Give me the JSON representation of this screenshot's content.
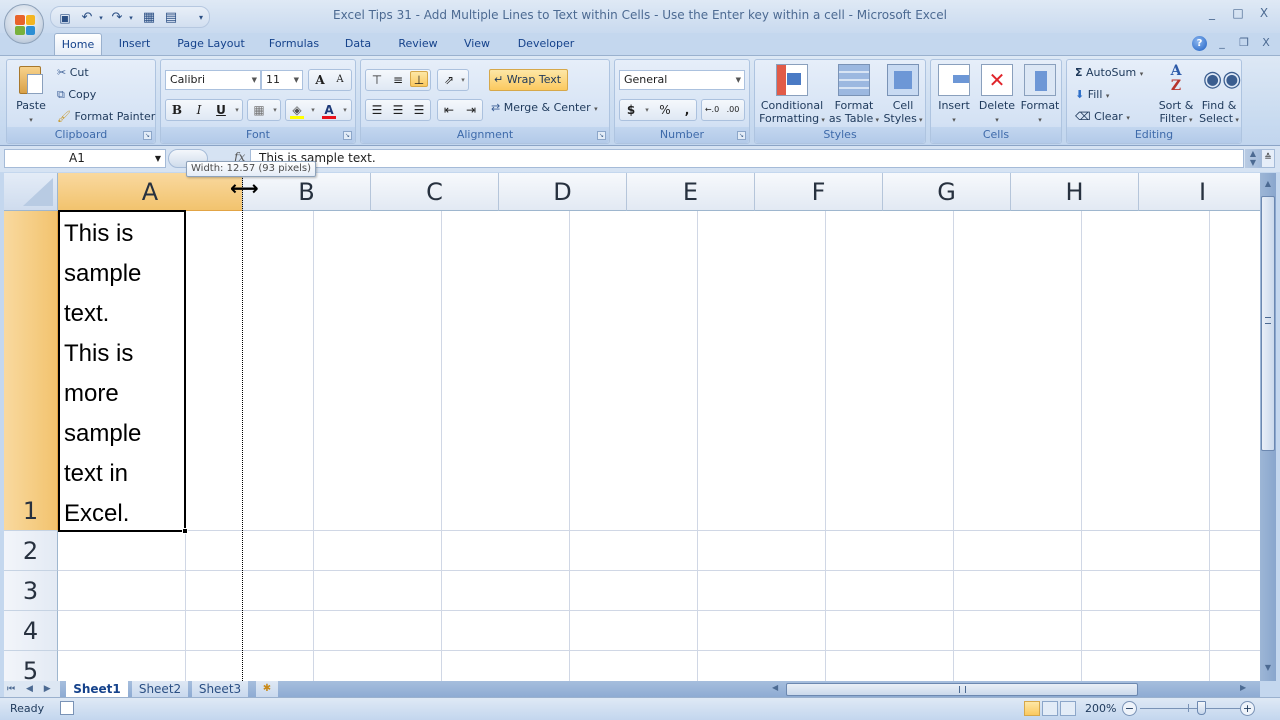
{
  "window": {
    "title": "Excel Tips 31 - Add Multiple Lines to Text within Cells - Use the Enter key within a cell - Microsoft Excel",
    "controls": {
      "minimize": "_",
      "maximize": "□",
      "close": "X"
    },
    "doc_controls": {
      "minimize": "_",
      "restore": "❐",
      "close": "X",
      "help": "?"
    }
  },
  "quick_access": [
    {
      "name": "save-icon",
      "glyph": "💾"
    },
    {
      "name": "undo-icon",
      "glyph": "↶"
    },
    {
      "name": "redo-icon",
      "glyph": "↷"
    },
    {
      "name": "print-preview-icon",
      "glyph": "▦"
    },
    {
      "name": "form-icon",
      "glyph": "▤"
    },
    {
      "name": "customize-icon",
      "glyph": "▾"
    }
  ],
  "tabs": [
    {
      "label": "Home",
      "active": true
    },
    {
      "label": "Insert"
    },
    {
      "label": "Page Layout"
    },
    {
      "label": "Formulas"
    },
    {
      "label": "Data"
    },
    {
      "label": "Review"
    },
    {
      "label": "View"
    },
    {
      "label": "Developer"
    }
  ],
  "ribbon": {
    "clipboard": {
      "label": "Clipboard",
      "paste": "Paste",
      "cut": "Cut",
      "copy": "Copy",
      "format_painter": "Format Painter"
    },
    "font": {
      "label": "Font",
      "font_name": "Calibri",
      "font_size": "11",
      "grow": "A",
      "shrink": "A",
      "bold": "B",
      "italic": "I",
      "underline": "U",
      "fill_color": "#ffff00",
      "font_color": "#ff0000"
    },
    "alignment": {
      "label": "Alignment",
      "wrap_text": "Wrap Text",
      "merge_center": "Merge & Center"
    },
    "number": {
      "label": "Number",
      "format": "General",
      "currency": "$",
      "percent": "%",
      "comma": ",",
      "inc_decimal": "←.0",
      "dec_decimal": ".00"
    },
    "styles": {
      "label": "Styles",
      "conditional_formatting": [
        "Conditional",
        "Formatting"
      ],
      "format_as_table": [
        "Format",
        "as Table"
      ],
      "cell_styles": [
        "Cell",
        "Styles"
      ]
    },
    "cells": {
      "label": "Cells",
      "insert": "Insert",
      "delete": "Delete",
      "format": "Format"
    },
    "editing": {
      "label": "Editing",
      "autosum": "AutoSum",
      "fill": "Fill",
      "clear": "Clear",
      "sort_filter": [
        "Sort &",
        "Filter"
      ],
      "find_select": [
        "Find &",
        "Select"
      ]
    }
  },
  "formula_bar": {
    "name_box": "A1",
    "fx": "fx",
    "content": "This is sample text."
  },
  "tooltip": "Width: 12.57 (93 pixels)",
  "sheet": {
    "columns": [
      "A",
      "B",
      "C",
      "D",
      "E",
      "F",
      "G",
      "H",
      "I"
    ],
    "rows": [
      "1",
      "2",
      "3",
      "4",
      "5"
    ],
    "cell_a1_lines": [
      "This is",
      "sample",
      "text.",
      "This is",
      "more",
      "sample",
      "text in",
      "Excel."
    ]
  },
  "sheet_tabs": [
    {
      "label": "Sheet1",
      "active": true
    },
    {
      "label": "Sheet2"
    },
    {
      "label": "Sheet3"
    }
  ],
  "sheet_nav": "⏮ ◀ ▶ ⏭",
  "status": {
    "text": "Ready",
    "zoom": "200%",
    "zoom_minus": "−",
    "zoom_plus": "+"
  },
  "colors": {
    "selection_header": "#f5c877",
    "ribbon_bg": "#c9daef",
    "gridline": "#d0d7e5"
  }
}
